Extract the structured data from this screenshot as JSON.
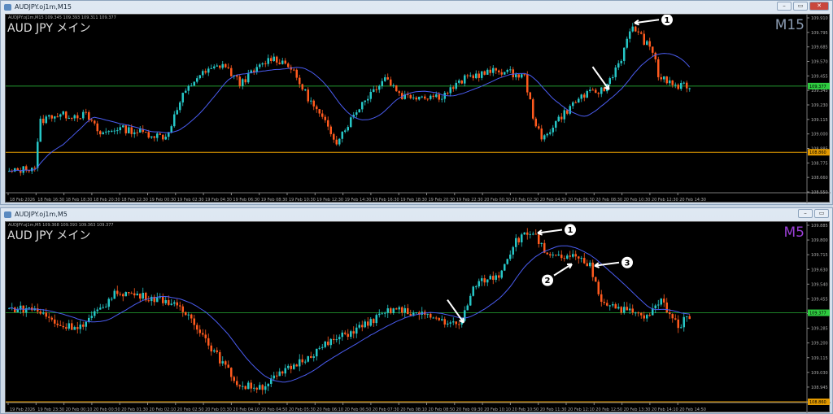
{
  "colors": {
    "bull": "#26c6c6",
    "bear": "#ff5a1e",
    "ma": "#4a5cf0",
    "bid": "#2ecc40",
    "level": "#e39a00",
    "grid": "#333"
  },
  "windows": [
    {
      "title": "AUDJPY.oj1m,M15",
      "header": "AUDJPY.oj1m,M15  109.345 109.393 109.311 109.377",
      "symbol": "AUD JPY  メイン",
      "timeframe": "M15",
      "tf_color": "#8a9ab0",
      "price_labels": [
        "109.910",
        "109.795",
        "109.685",
        "109.570",
        "109.455",
        "109.345",
        "109.230",
        "109.115",
        "109.000",
        "108.885",
        "108.775",
        "108.660",
        "108.550"
      ],
      "price_range": [
        108.55,
        109.91
      ],
      "current": "109.377",
      "current_price": 109.377,
      "level": "108.860",
      "level_price": 108.86,
      "time_labels": [
        "18 Feb 2026",
        "18 Feb 16:30",
        "18 Feb 18:30",
        "18 Feb 20:30",
        "18 Feb 22:30",
        "19 Feb 00:30",
        "19 Feb 02:30",
        "19 Feb 04:30",
        "19 Feb 06:30",
        "19 Feb 08:30",
        "19 Feb 10:30",
        "19 Feb 12:30",
        "19 Feb 14:30",
        "19 Feb 16:30",
        "19 Feb 18:30",
        "19 Feb 20:30",
        "19 Feb 22:30",
        "20 Feb 00:30",
        "20 Feb 02:30",
        "20 Feb 04:30",
        "20 Feb 06:30",
        "20 Feb 08:30",
        "20 Feb 10:30",
        "20 Feb 12:30",
        "20 Feb 14:30"
      ],
      "bars": 240,
      "path": [
        [
          0,
          108.7
        ],
        [
          9,
          108.75
        ],
        [
          11,
          109.1
        ],
        [
          15,
          109.15
        ],
        [
          27,
          109.15
        ],
        [
          32,
          109.0
        ],
        [
          38,
          109.05
        ],
        [
          55,
          108.98
        ],
        [
          61,
          109.3
        ],
        [
          66,
          109.45
        ],
        [
          75,
          109.55
        ],
        [
          81,
          109.4
        ],
        [
          92,
          109.6
        ],
        [
          98,
          109.55
        ],
        [
          106,
          109.25
        ],
        [
          115,
          108.95
        ],
        [
          124,
          109.25
        ],
        [
          132,
          109.45
        ],
        [
          138,
          109.3
        ],
        [
          152,
          109.3
        ],
        [
          161,
          109.45
        ],
        [
          172,
          109.5
        ],
        [
          181,
          109.45
        ],
        [
          184,
          109.15
        ],
        [
          187,
          108.95
        ],
        [
          192,
          109.1
        ],
        [
          201,
          109.3
        ],
        [
          209,
          109.35
        ],
        [
          215,
          109.6
        ],
        [
          219,
          109.85
        ],
        [
          224,
          109.7
        ],
        [
          227,
          109.6
        ],
        [
          228,
          109.45
        ],
        [
          235,
          109.37
        ],
        [
          238,
          109.377
        ]
      ],
      "annotations": [
        {
          "label": "1",
          "bar": 220,
          "price": 109.87,
          "dir": "left"
        },
        {
          "label": "",
          "bar": 211,
          "price": 109.35,
          "dir": "down"
        }
      ]
    },
    {
      "title": "AUDJPY.oj1m,M5",
      "header": "AUDJPY.oj1m,M5  109.368 109.393 109.363 109.377",
      "symbol": "AUD JPY  メイン",
      "timeframe": "M5",
      "tf_color": "#9b3fd6",
      "price_labels": [
        "109.885",
        "109.800",
        "109.715",
        "109.630",
        "109.540",
        "109.455",
        "109.370",
        "109.285",
        "109.200",
        "109.115",
        "109.030",
        "108.945",
        "108.860"
      ],
      "price_range": [
        108.86,
        109.885
      ],
      "current": "109.377",
      "current_price": 109.377,
      "level": "108.860",
      "level_price": 108.86,
      "time_labels": [
        "19 Feb 2026",
        "19 Feb 23:30",
        "20 Feb 00:10",
        "20 Feb 00:50",
        "20 Feb 01:30",
        "20 Feb 02:10",
        "20 Feb 02:50",
        "20 Feb 03:30",
        "20 Feb 04:10",
        "20 Feb 04:50",
        "20 Feb 05:30",
        "20 Feb 06:10",
        "20 Feb 06:50",
        "20 Feb 07:30",
        "20 Feb 08:10",
        "20 Feb 08:50",
        "20 Feb 09:30",
        "20 Feb 10:10",
        "20 Feb 10:50",
        "20 Feb 11:30",
        "20 Feb 12:10",
        "20 Feb 12:50",
        "20 Feb 13:30",
        "20 Feb 14:10",
        "20 Feb 14:50"
      ],
      "bars": 240,
      "path": [
        [
          0,
          109.4
        ],
        [
          9,
          109.4
        ],
        [
          18,
          109.3
        ],
        [
          26,
          109.3
        ],
        [
          38,
          109.5
        ],
        [
          55,
          109.45
        ],
        [
          64,
          109.35
        ],
        [
          72,
          109.15
        ],
        [
          81,
          108.95
        ],
        [
          89,
          108.95
        ],
        [
          98,
          109.05
        ],
        [
          112,
          109.2
        ],
        [
          124,
          109.3
        ],
        [
          135,
          109.4
        ],
        [
          149,
          109.35
        ],
        [
          158,
          109.3
        ],
        [
          164,
          109.55
        ],
        [
          172,
          109.6
        ],
        [
          178,
          109.8
        ],
        [
          184,
          109.85
        ],
        [
          189,
          109.7
        ],
        [
          198,
          109.7
        ],
        [
          204,
          109.65
        ],
        [
          208,
          109.45
        ],
        [
          215,
          109.4
        ],
        [
          224,
          109.35
        ],
        [
          229,
          109.45
        ],
        [
          235,
          109.3
        ],
        [
          240,
          109.377
        ]
      ],
      "annotations": [
        {
          "label": "1",
          "bar": 186,
          "price": 109.84,
          "dir": "left"
        },
        {
          "label": "2",
          "bar": 198,
          "price": 109.66,
          "dir": "upright"
        },
        {
          "label": "3",
          "bar": 206,
          "price": 109.65,
          "dir": "left"
        },
        {
          "label": "",
          "bar": 160,
          "price": 109.32,
          "dir": "down"
        }
      ]
    }
  ]
}
